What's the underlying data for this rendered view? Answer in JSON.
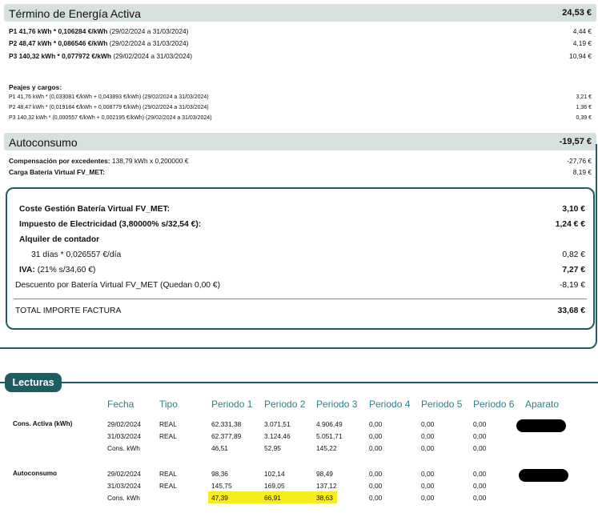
{
  "energia": {
    "title": "Término de Energía Activa",
    "total": "24,53 €",
    "lines": [
      {
        "prefix": "P1 41,76 kWh * 0,106284 €/kWh",
        "dates": " (29/02/2024 a 31/03/2024)",
        "amount": "4,44 €"
      },
      {
        "prefix": "P2 48,47 kWh * 0,086546 €/kWh",
        "dates": " (29/02/2024 a 31/03/2024)",
        "amount": "4,19 €"
      },
      {
        "prefix": "P3 140,32 kWh * 0,077972 €/kWh",
        "dates": " (29/02/2024 a 31/03/2024)",
        "amount": "10,94 €"
      }
    ]
  },
  "peajes": {
    "title": "Peajes y cargos:",
    "lines": [
      {
        "text": "P1 41,76 kWh * (0,033081 €/kWh + 0,043893 €/kWh) (29/02/2024 a 31/03/2024)",
        "amount": "3,21 €"
      },
      {
        "text": "P2 48,47 kWh * (0,019184 €/kWh + 0,008779 €/kWh) (29/02/2024 a 31/03/2024)",
        "amount": "1,36 €"
      },
      {
        "text": "P3 140,32 kWh * (0,000557 €/kWh + 0,002195 €/kWh) (29/02/2024 a 31/03/2024)",
        "amount": "0,39 €"
      }
    ]
  },
  "autoconsumo": {
    "title": "Autoconsumo",
    "total": "-19,57 €",
    "compensacion_label": "Compensación por excedentes:",
    "compensacion_detail": " 138,79 kWh x 0,200000 €",
    "compensacion_amount": "-27,76 €",
    "carga_label": "Carga Batería Virtual FV_MET:",
    "carga_amount": "8,19 €"
  },
  "summary": {
    "coste_label": "Coste Gestión Batería Virtual FV_MET:",
    "coste_amount": "3,10 €",
    "impuesto_label": "Impuesto de Electricidad (3,80000% s/32,54 €):",
    "impuesto_amount": "1,24 € €",
    "alquiler_label": "Alquiler de contador",
    "alquiler_detail": "31 días * 0,026557 €/día",
    "alquiler_amount": "0,82 €",
    "iva_label": "IVA:",
    "iva_detail": " (21% s/34,60 €)",
    "iva_amount": "7,27 €",
    "descuento_label": "Descuento por Batería Virtual FV_MET (Quedan 0,00 €)",
    "descuento_amount": "-8,19 €",
    "total_label": "TOTAL IMPORTE FACTURA",
    "total_amount": "33,68 €"
  },
  "lecturas": {
    "tab_label": "Lecturas",
    "headers": [
      "Fecha",
      "Tipo",
      "Periodo 1",
      "Periodo 2",
      "Periodo 3",
      "Periodo 4",
      "Periodo 5",
      "Periodo 6",
      "Aparato"
    ],
    "groups": [
      {
        "label": "Cons. Activa (kWh)",
        "rows": [
          [
            "29/02/2024",
            "REAL",
            "62.331,38",
            "3.071,51",
            "4.906,49",
            "0,00",
            "0,00",
            "0,00"
          ],
          [
            "31/03/2024",
            "REAL",
            "62.377,89",
            "3.124,46",
            "5.051,71",
            "0,00",
            "0,00",
            "0,00"
          ],
          [
            "Cons. kWh",
            "",
            "46,51",
            "52,95",
            "145,22",
            "0,00",
            "0,00",
            "0,00"
          ]
        ]
      },
      {
        "label": "Autoconsumo",
        "rows": [
          [
            "29/02/2024",
            "REAL",
            "98,36",
            "102,14",
            "98,49",
            "0,00",
            "0,00",
            "0,00"
          ],
          [
            "31/03/2024",
            "REAL",
            "145,75",
            "169,05",
            "137,12",
            "0,00",
            "0,00",
            "0,00"
          ],
          [
            "Cons. kWh",
            "",
            "47,39",
            "66,91",
            "38,63",
            "0,00",
            "0,00",
            "0,00"
          ]
        ]
      }
    ]
  },
  "colors": {
    "accent": "#1e5c61",
    "header_bg": "#d5e0df",
    "highlight": "#f7ec1c",
    "table_header": "#2f7f86"
  }
}
